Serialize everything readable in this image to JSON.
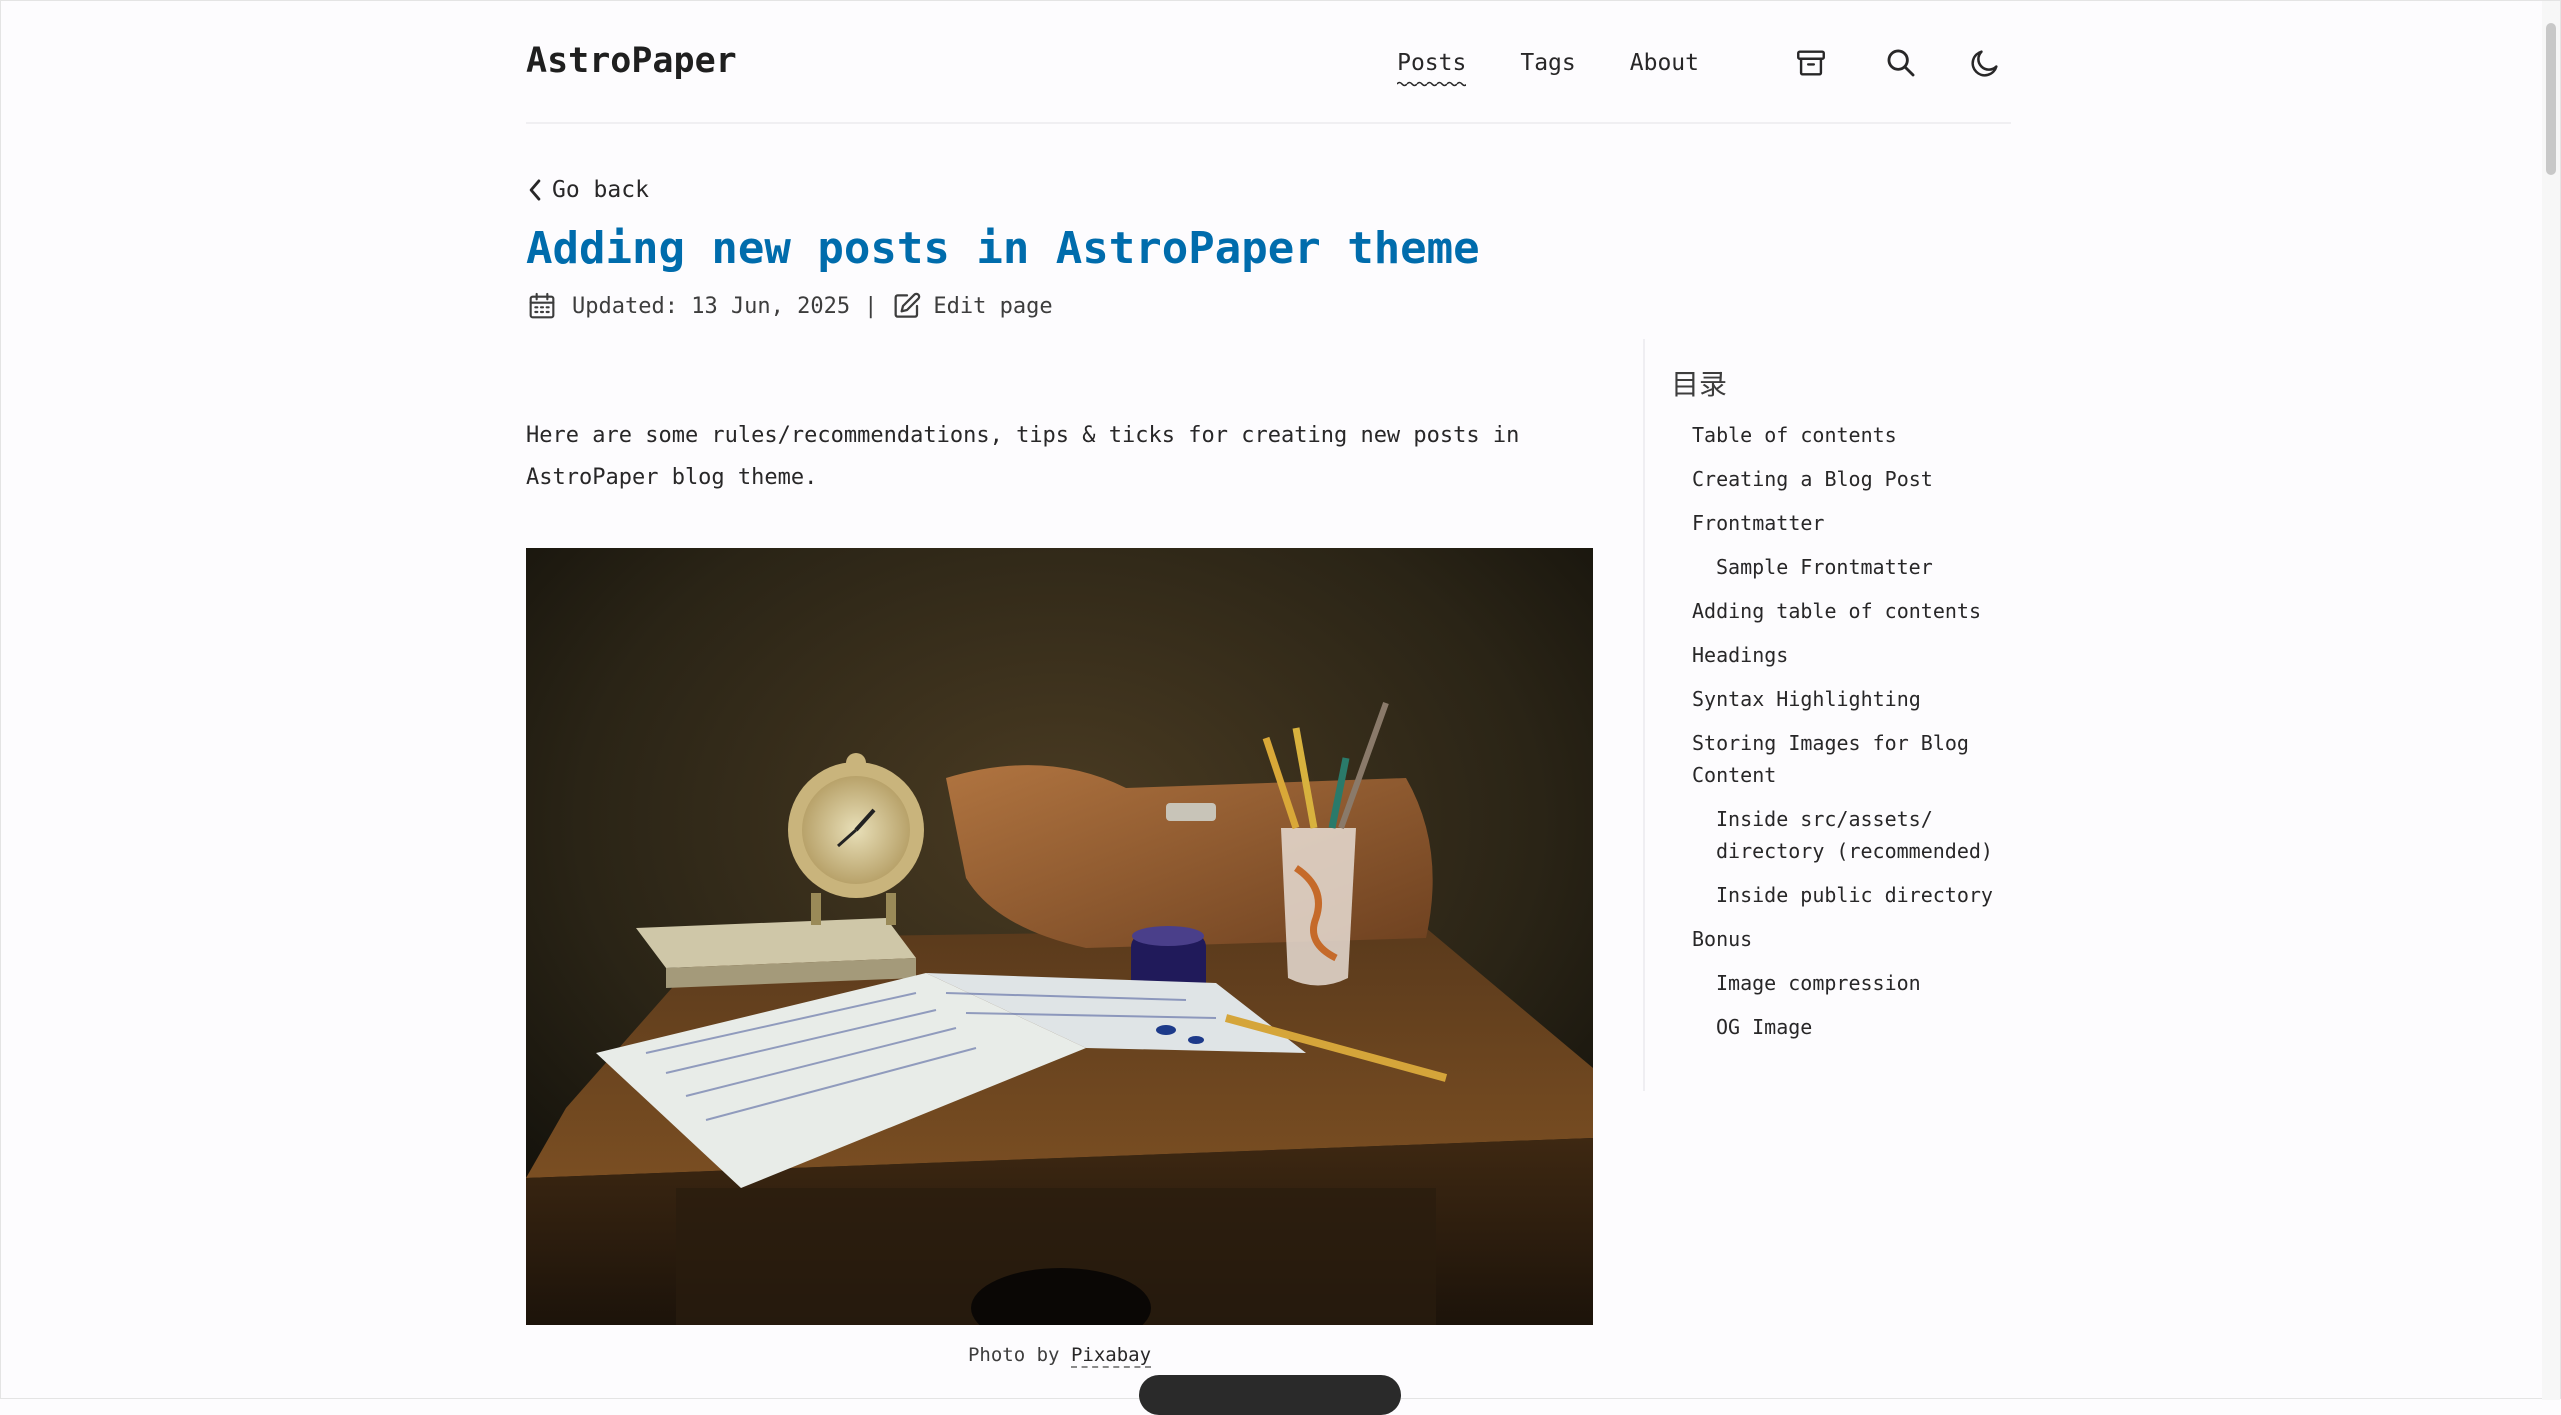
{
  "header": {
    "brand": "AstroPaper",
    "nav": [
      {
        "label": "Posts",
        "active": true
      },
      {
        "label": "Tags",
        "active": false
      },
      {
        "label": "About",
        "active": false
      }
    ],
    "icons": [
      "archive-icon",
      "search-icon",
      "moon-icon"
    ]
  },
  "post": {
    "back_label": "Go back",
    "title": "Adding new posts in AstroPaper theme",
    "updated": "Updated: 13 Jun, 2025",
    "separator": "|",
    "edit_label": "Edit page",
    "intro": "Here are some rules/recommendations, tips & ticks for creating new posts in AstroPaper blog theme.",
    "caption_prefix": "Photo by",
    "caption_link": "Pixabay"
  },
  "toc": {
    "title": "目录",
    "items": [
      {
        "label": "Table of contents",
        "level": 1
      },
      {
        "label": "Creating a Blog Post",
        "level": 1
      },
      {
        "label": "Frontmatter",
        "level": 1
      },
      {
        "label": "Sample Frontmatter",
        "level": 2
      },
      {
        "label": "Adding table of contents",
        "level": 1
      },
      {
        "label": "Headings",
        "level": 1
      },
      {
        "label": "Syntax Highlighting",
        "level": 1
      },
      {
        "label": "Storing Images for Blog Content",
        "level": 1
      },
      {
        "label": "Inside src/assets/ directory (recommended)",
        "level": 2
      },
      {
        "label": "Inside public directory",
        "level": 2
      },
      {
        "label": "Bonus",
        "level": 1
      },
      {
        "label": "Image compression",
        "level": 2
      },
      {
        "label": "OG Image",
        "level": 2
      }
    ]
  },
  "colors": {
    "accent": "#006cac",
    "text": "#282728",
    "background": "#fdfcfe"
  }
}
